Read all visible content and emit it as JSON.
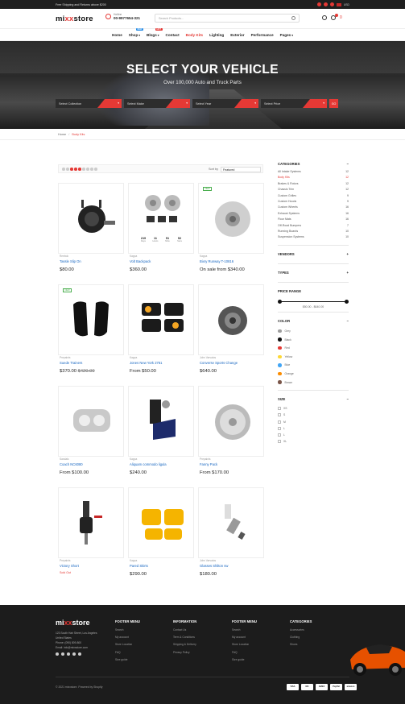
{
  "topbar": {
    "promo": "Free Shipping and Returns above $200",
    "badge1": "0",
    "badge2": "0",
    "lang": "USD"
  },
  "header": {
    "logo_a": "mi",
    "logo_x": "xx",
    "logo_b": "store",
    "phone_label": "Hotline",
    "phone": "00-9977654-321",
    "search_placeholder": "Search Products...",
    "cart_count": "0"
  },
  "nav": [
    {
      "label": "Home",
      "tag": ""
    },
    {
      "label": "Shop",
      "tag": "NEW",
      "tag_color": "#1e88e5"
    },
    {
      "label": "Blogs",
      "tag": "HOT",
      "tag_color": "#e53935"
    },
    {
      "label": "Contact",
      "tag": ""
    },
    {
      "label": "Body Kits",
      "tag": "",
      "active": true
    },
    {
      "label": "Lighting",
      "tag": ""
    },
    {
      "label": "Exterior",
      "tag": ""
    },
    {
      "label": "Performance",
      "tag": ""
    },
    {
      "label": "Pages",
      "tag": ""
    }
  ],
  "hero": {
    "title": "SELECT YOUR VEHICLE",
    "subtitle": "Over 100,000 Auto and Truck Parts",
    "selects": [
      "Select Collection",
      "Select Make",
      "Select Year",
      "Select Price"
    ],
    "go": "GO"
  },
  "breadcrumb": {
    "home": "Home",
    "sep": "/",
    "current": "Body Kits"
  },
  "toolbar": {
    "sort_label": "Sort by",
    "sort_value": "Featured"
  },
  "products": [
    {
      "vendor": "Reebok",
      "name": "Tassle Slip On",
      "price": "$80.00",
      "old": "",
      "new_tag": false
    },
    {
      "vendor": "Kappa",
      "name": "Volt Backpack",
      "price": "$360.00",
      "old": "",
      "new_tag": false,
      "countdown": [
        "219",
        "11",
        "51",
        "52"
      ],
      "countdown_labels": [
        "Days",
        "Hours",
        "Mins",
        "Secs"
      ]
    },
    {
      "vendor": "Kappa",
      "name": "Bixry Runway T-10816",
      "price": "On sale from $340.00",
      "old": "",
      "new_tag": true
    },
    {
      "vendor": "Prepaints",
      "name": "Suede Trainers",
      "price": "$370.00",
      "old": "$420.00",
      "new_tag": true
    },
    {
      "vendor": "Kappa",
      "name": "Jones New York 2761",
      "price": "From $50.00",
      "old": "",
      "new_tag": false
    },
    {
      "vendor": "John Varvatos",
      "name": "Converse Sports Change",
      "price": "$640.00",
      "old": "",
      "new_tag": false
    },
    {
      "vendor": "Sandals",
      "name": "Coach NC6080",
      "price": "From $100.00",
      "old": "",
      "new_tag": false
    },
    {
      "vendor": "Kappa",
      "name": "Aliquam commodo ligula",
      "price": "$240.00",
      "old": "",
      "new_tag": false
    },
    {
      "vendor": "Prepaints",
      "name": "Fanny Pack",
      "price": "From $170.00",
      "old": "",
      "new_tag": false
    },
    {
      "vendor": "Prepaints",
      "name": "Victory Short",
      "price": "",
      "old": "",
      "sold": "Sold Out",
      "new_tag": false
    },
    {
      "vendor": "Kappa",
      "name": "Pared Skirts",
      "price": "$290.00",
      "old": "",
      "new_tag": false
    },
    {
      "vendor": "John Varvatos",
      "name": "Glasses Shilton sw",
      "price": "$180.00",
      "old": "",
      "new_tag": false
    }
  ],
  "sidebar": {
    "categories_title": "CATEGORIES",
    "categories": [
      {
        "name": "All Intake Systems",
        "count": "12"
      },
      {
        "name": "Body Kits",
        "count": "12",
        "active": true
      },
      {
        "name": "Brakes & Rotors",
        "count": "12"
      },
      {
        "name": "Chassis Trim",
        "count": "12"
      },
      {
        "name": "Custom Grilles",
        "count": "9"
      },
      {
        "name": "Custom Hoods",
        "count": "9"
      },
      {
        "name": "Custom Wheels",
        "count": "16"
      },
      {
        "name": "Exhaust Systems",
        "count": "16"
      },
      {
        "name": "Floor Mats",
        "count": "16"
      },
      {
        "name": "Off-Road Bumpers",
        "count": "7"
      },
      {
        "name": "Running Boards",
        "count": "10"
      },
      {
        "name": "Suspension Systems",
        "count": "10"
      }
    ],
    "vendors_title": "VENDORS",
    "types_title": "TYPES",
    "price_title": "PRICE RANGE",
    "price_value": "$50.00 - $640.00",
    "color_title": "COLOR",
    "colors": [
      {
        "name": "Grey",
        "hex": "#9e9e9e"
      },
      {
        "name": "Black",
        "hex": "#111111"
      },
      {
        "name": "Red",
        "hex": "#e53935"
      },
      {
        "name": "Yellow",
        "hex": "#fdd835"
      },
      {
        "name": "Blue",
        "hex": "#42a5f5"
      },
      {
        "name": "Orange",
        "hex": "#fb8c00"
      },
      {
        "name": "Brown",
        "hex": "#795548"
      }
    ],
    "size_title": "SIZE",
    "sizes": [
      "XS",
      "S",
      "M",
      "L",
      "L",
      "XL"
    ]
  },
  "footer": {
    "logo_a": "mi",
    "logo_x": "xx",
    "logo_b": "store",
    "address": [
      "123 South Hair Street, Los Angeles",
      "United States",
      "Phone: (090) 809-800",
      "Email: info@mixxstore.com"
    ],
    "columns": [
      {
        "title": "FOOTER MENU",
        "links": [
          "Search",
          "My account",
          "Store Location",
          "FAQ",
          "Size guide"
        ]
      },
      {
        "title": "INFORMATION",
        "links": [
          "Contact Us",
          "Term & Conditions",
          "Shipping & Delivery",
          "Privacy Policy"
        ]
      },
      {
        "title": "FOOTER MENU",
        "links": [
          "Search",
          "My account",
          "Store Location",
          "FAQ",
          "Size guide"
        ]
      },
      {
        "title": "CATEGORIES",
        "links": [
          "Accessories",
          "Clothing",
          "Shoes"
        ]
      }
    ],
    "copyright": "© 2021 mixxstore. Powered by Shopify",
    "payments": [
      "VISA",
      "MC",
      "AMEX",
      "PayPal",
      "amazon"
    ]
  }
}
